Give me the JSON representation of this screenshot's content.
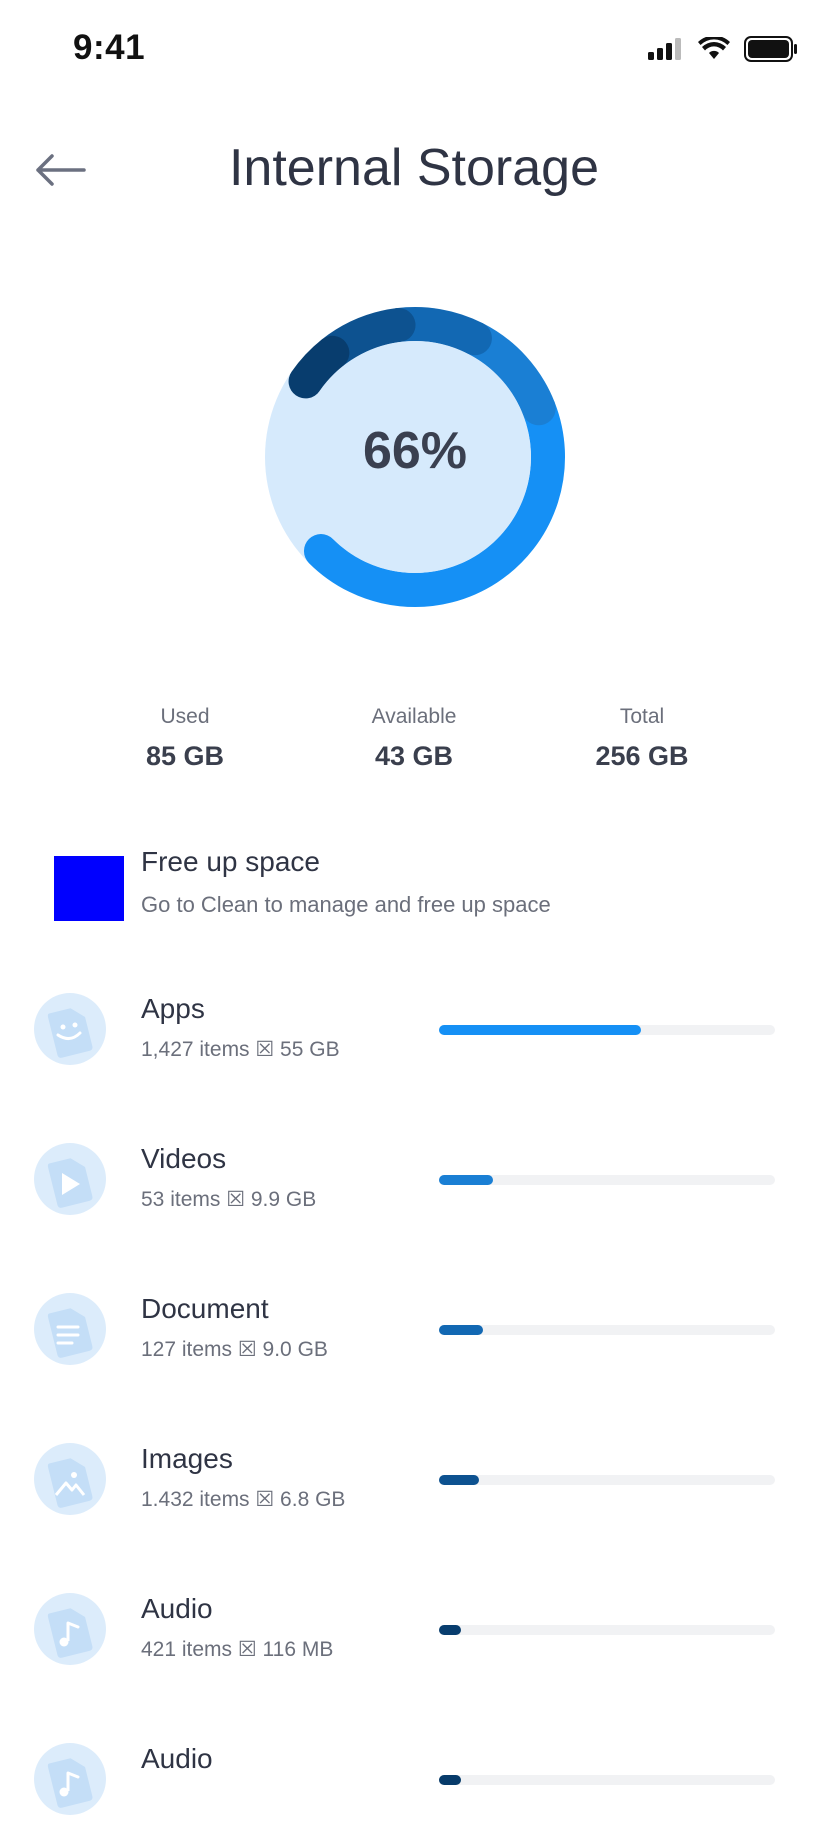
{
  "status_bar": {
    "time": "9:41",
    "icons": [
      "signal-icon",
      "wifi-icon",
      "battery-icon"
    ]
  },
  "header": {
    "title": "Internal Storage",
    "back_icon": "arrow-left-icon"
  },
  "donut": {
    "center_text": "66%",
    "used_fraction": 0.66
  },
  "stats": [
    {
      "label": "Used",
      "value": "85 GB"
    },
    {
      "label": "Available",
      "value": "43 GB"
    },
    {
      "label": "Total",
      "value": "256 GB"
    }
  ],
  "free_up": {
    "title": "Free up space",
    "subtitle": "Go to Clean to manage and free up space",
    "icon_color": "#0000ff"
  },
  "categories": [
    {
      "title": "Apps",
      "subtitle": "1,427 items ☒ 55 GB",
      "fraction": 0.6,
      "color": "#1590f5",
      "icon": "apps-file-icon"
    },
    {
      "title": "Videos",
      "subtitle": "53 items ☒ 9.9 GB",
      "fraction": 0.16,
      "color": "#1a7fd4",
      "icon": "video-file-icon"
    },
    {
      "title": "Document",
      "subtitle": "127 items ☒ 9.0 GB",
      "fraction": 0.13,
      "color": "#1268b3",
      "icon": "document-file-icon"
    },
    {
      "title": "Images",
      "subtitle": "1.432 items ☒ 6.8 GB",
      "fraction": 0.12,
      "color": "#0d5290",
      "icon": "image-file-icon"
    },
    {
      "title": "Audio",
      "subtitle": "421 items ☒ 116 MB",
      "fraction": 0.065,
      "color": "#083d6e",
      "icon": "audio-file-icon"
    },
    {
      "title": "Audio",
      "subtitle": "",
      "fraction": 0.065,
      "color": "#073b6a",
      "icon": "audio-file-icon"
    }
  ],
  "colors": {
    "accent": "#1590f5",
    "donut_track": "#d6eafc",
    "donut_segments": [
      "#1590f5",
      "#1a7fd4",
      "#1268b3",
      "#0d5290",
      "#083d6e"
    ]
  }
}
